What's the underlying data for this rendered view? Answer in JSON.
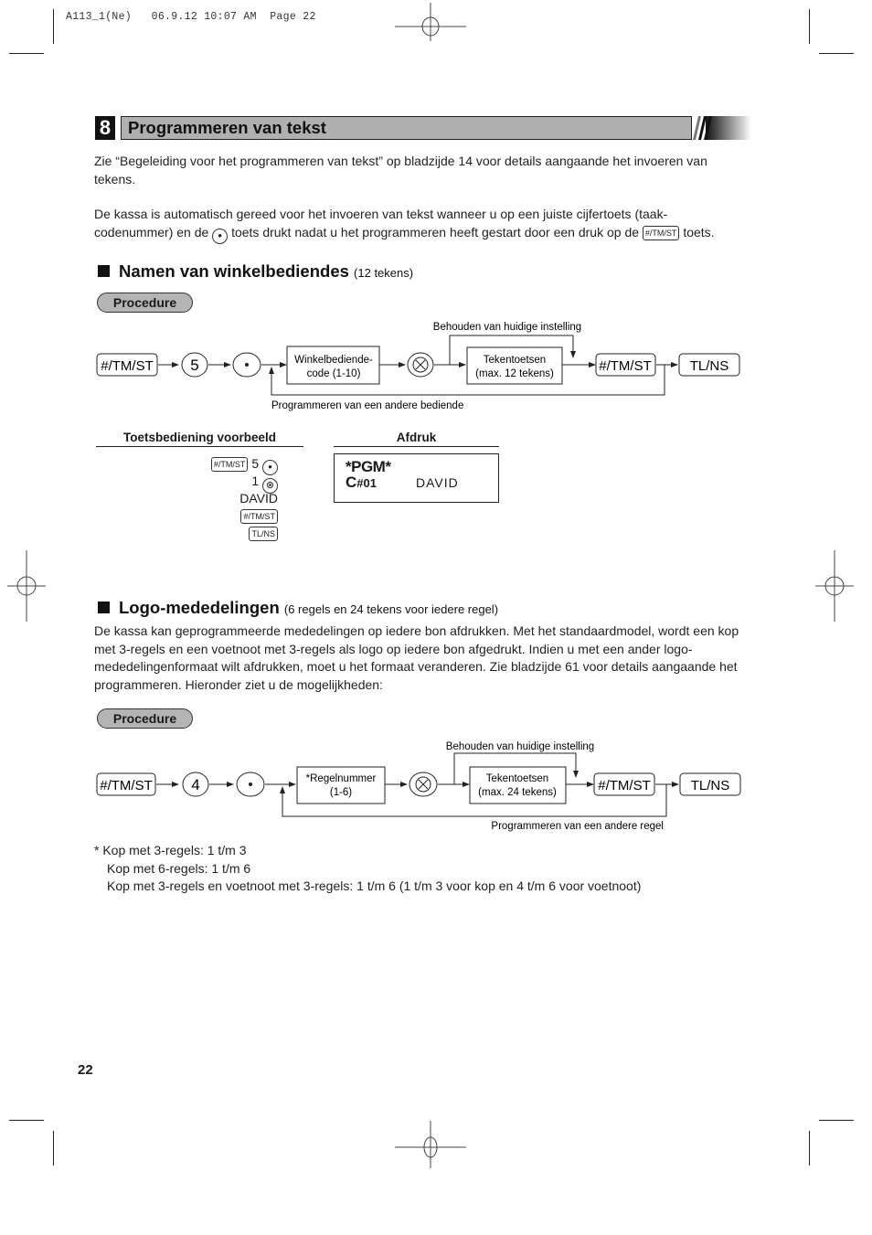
{
  "print_meta": "A113_1(Ne)   06.9.12 10:07 AM  Page 22",
  "section": {
    "number": "8",
    "title": "Programmeren van tekst"
  },
  "intro": {
    "para1": "Zie “Begeleiding voor het programmeren van tekst” op bladzijde 14 voor details aangaande het invoeren van tekens.",
    "para2_a": "De kassa is automatisch gereed voor het invoeren van tekst wanneer u op een juiste cijfertoets (taak-codenummer) en de ",
    "para2_b": " toets drukt nadat u het programmeren heeft gestart door een druk op de ",
    "para2_c": " toets.",
    "dot_key": "•",
    "tmst_key": "#/TM/ST"
  },
  "clerk_names": {
    "heading": "Namen van winkelbediendes",
    "subheading": "(12 tekens)",
    "procedure_label": "Procedure",
    "flow": {
      "keys": [
        "#/TM/ST",
        "5",
        "•"
      ],
      "box1": [
        "Winkelbediende-",
        "code (1-10)"
      ],
      "multiply_key": "⊗",
      "box2": [
        "Tekentoetsen",
        "(max. 12 tekens)"
      ],
      "end_keys": [
        "#/TM/ST",
        "TL/NS"
      ],
      "skip_label": "Behouden van huidige instelling",
      "loop_label": "Programmeren van een andere bediende"
    },
    "example": {
      "header_keys": "Toetsbediening voorbeeld",
      "header_print": "Afdruk",
      "rows": [
        {
          "key": "#/TM/ST",
          "text": "5",
          "icon": "•"
        },
        {
          "text": "1",
          "icon": "⊗"
        },
        {
          "text": "DAVID"
        },
        {
          "key": "#/TM/ST"
        },
        {
          "key": "TL/NS"
        }
      ],
      "receipt_line1": "*PGM*",
      "receipt_line2_prefix": "C",
      "receipt_line2_num": "#01",
      "receipt_name": "DAVID"
    }
  },
  "logo_messages": {
    "heading": "Logo-mededelingen",
    "subheading": "(6 regels en 24 tekens voor iedere regel)",
    "body": "De kassa kan geprogrammeerde mededelingen op iedere bon afdrukken. Met het standaardmodel, wordt een kop met 3-regels en een voetnoot met 3-regels als logo op iedere bon afgedrukt. Indien u met een ander logo-mededelingenformaat wilt afdrukken, moet u het formaat veranderen. Zie bladzijde 61 voor details aangaande het programmeren. Hieronder ziet u de mogelijkheden:",
    "procedure_label": "Procedure",
    "flow": {
      "keys": [
        "#/TM/ST",
        "4",
        "•"
      ],
      "box1": [
        "*Regelnummer",
        "(1-6)"
      ],
      "multiply_key": "⊗",
      "box2": [
        "Tekentoetsen",
        "(max. 24 tekens)"
      ],
      "end_keys": [
        "#/TM/ST",
        "TL/NS"
      ],
      "skip_label": "Behouden van huidige instelling",
      "loop_label": "Programmeren van een andere regel"
    },
    "footnotes": [
      "*  Kop met 3-regels: 1 t/m 3",
      "Kop met 6-regels: 1 t/m 6",
      "Kop met 3-regels en voetnoot met 3-regels: 1 t/m 6 (1 t/m 3 voor kop en 4 t/m 6 voor voetnoot)"
    ]
  },
  "page_number": "22"
}
